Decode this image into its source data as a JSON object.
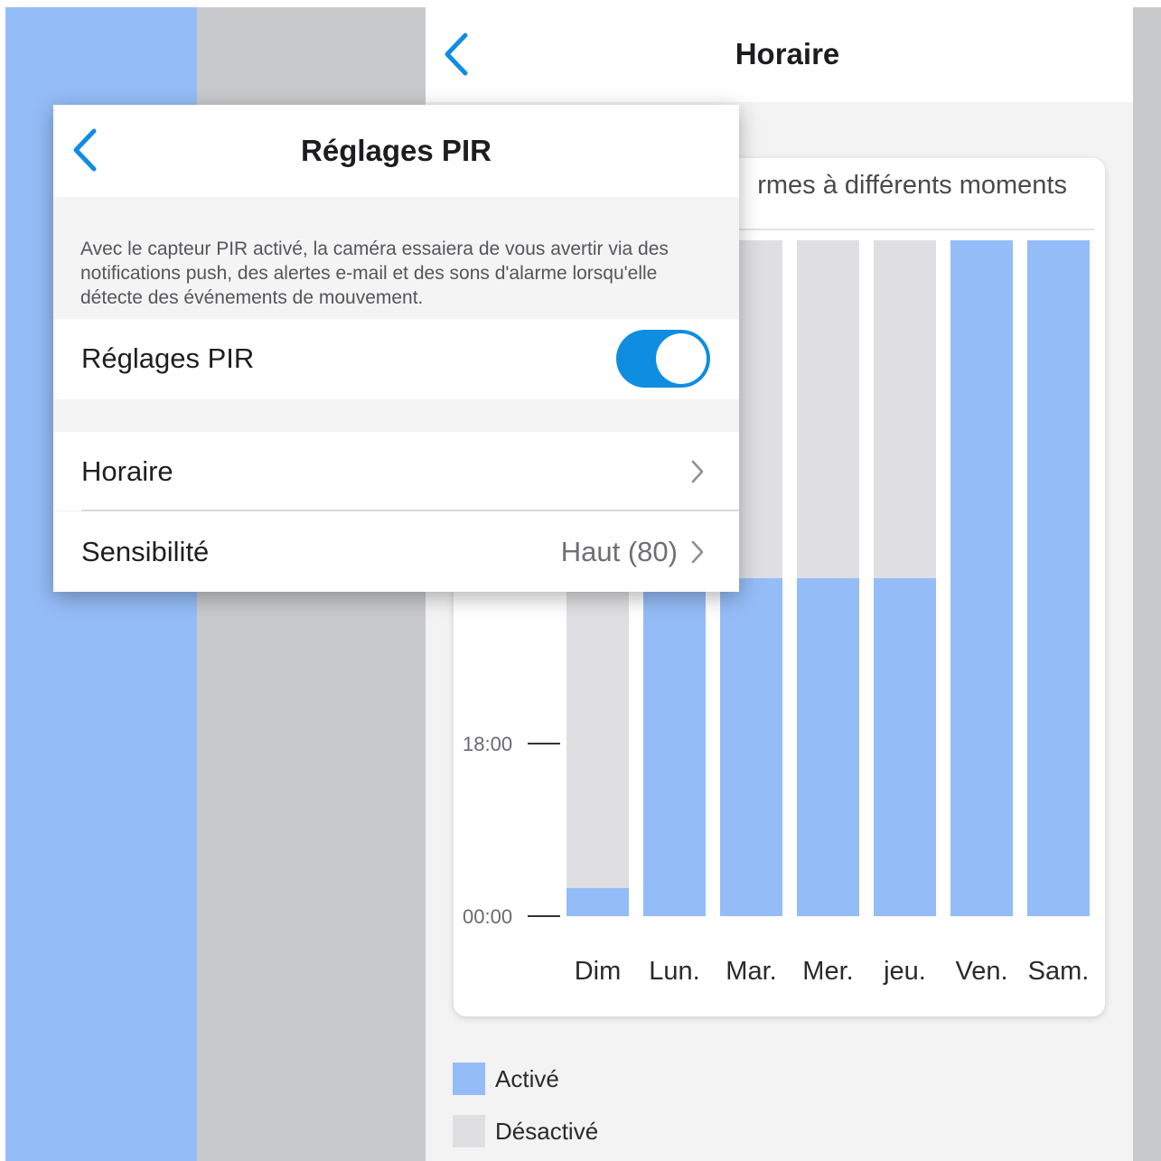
{
  "schedule_screen": {
    "title": "Horaire",
    "chart_caption": "rmes à différents moments",
    "legend": [
      {
        "label": "Activé",
        "color": "#94bcf7"
      },
      {
        "label": "Désactivé",
        "color": "#dfdfe1"
      }
    ]
  },
  "pir_panel": {
    "title": "Réglages PIR",
    "description": "Avec le capteur PIR activé, la caméra essaiera de vous avertir via des notifications push, des alertes e-mail et des sons d'alarme lorsqu'elle détecte des événements de mouvement.",
    "toggle_row": {
      "label": "Réglages PIR",
      "enabled": true
    },
    "schedule_row": {
      "label": "Horaire"
    },
    "sensitivity_row": {
      "label": "Sensibilité",
      "value": "Haut (80)"
    }
  },
  "icons": {
    "back": "chevron-left-icon",
    "row_arrow": "chevron-right-icon"
  },
  "colors": {
    "accent": "#0f8de0",
    "active": "#94bcf7",
    "inactive": "#dfdfe1"
  },
  "chart_data": {
    "type": "bar",
    "categories": [
      "Dim",
      "Lun.",
      "Mar.",
      "Mer.",
      "jeu.",
      "Ven.",
      "Sam."
    ],
    "y_ticks": [
      "00:00",
      "18:00"
    ],
    "ylim_hours": [
      0,
      24
    ],
    "active_ranges_hours": [
      [
        0,
        1
      ],
      [
        0,
        12
      ],
      [
        0,
        12
      ],
      [
        0,
        12
      ],
      [
        0,
        12
      ],
      [
        0,
        24
      ],
      [
        0,
        24
      ]
    ],
    "legend": [
      "Activé",
      "Désactivé"
    ]
  }
}
